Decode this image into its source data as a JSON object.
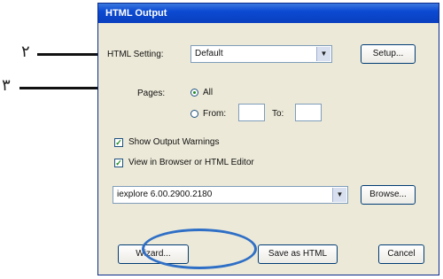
{
  "annotations": [
    {
      "number": "٢"
    },
    {
      "number": "٣"
    }
  ],
  "dialog": {
    "title": "HTML Output",
    "setting_label": "HTML Setting:",
    "setting_value": "Default",
    "setup_button": "Setup...",
    "pages_label": "Pages:",
    "all_label": "All",
    "from_label": "From:",
    "from_value": "",
    "to_label": "To:",
    "to_value": "",
    "show_warnings_label": "Show Output Warnings",
    "show_warnings_checked": true,
    "view_in_browser_label": "View in Browser or HTML Editor",
    "view_in_browser_checked": true,
    "browser_value": "iexplore 6.00.2900.2180",
    "browse_button": "Browse...",
    "wizard_button": "Wizard...",
    "save_button": "Save as HTML",
    "cancel_button": "Cancel"
  },
  "colors": {
    "titlebar": "#0b4ad2",
    "dialog_bg": "#ece9d8",
    "highlight_oval": "#2f6fc6"
  }
}
